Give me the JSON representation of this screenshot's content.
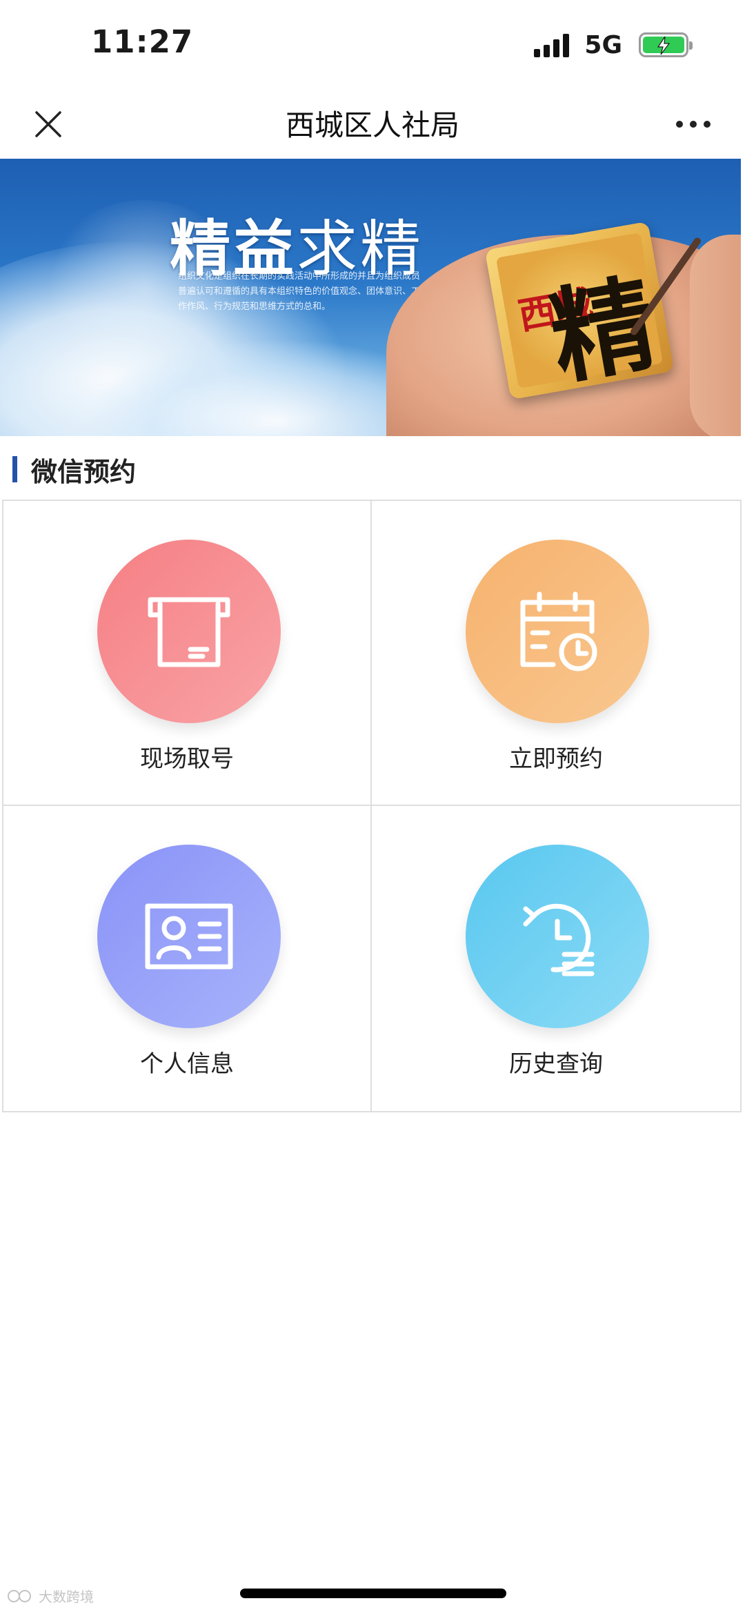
{
  "status_bar": {
    "time": "11:27",
    "network": "5G",
    "battery_level": 1.0,
    "battery_color": "#2fcb55"
  },
  "nav": {
    "title": "西城区人社局",
    "close_icon": "close-icon",
    "more_icon": "more-dots-icon"
  },
  "banner": {
    "headline_bold": "精益",
    "headline_light": "求精",
    "description": "组织文化是组织在长期的实践活动中所形成的并且为组织成员普遍认可和遵循的具有本组织特色的价值观念、团体意识、工作作风、行为规范和思维方式的总和。",
    "seal_char": "精",
    "seal_side": "西城"
  },
  "section": {
    "title": "微信预约",
    "accent": "#2452a8"
  },
  "services": [
    {
      "label": "现场取号",
      "icon": "ticket-icon",
      "color": "#f67f84"
    },
    {
      "label": "立即预约",
      "icon": "calendar-clock-icon",
      "color": "#f6b26e"
    },
    {
      "label": "个人信息",
      "icon": "id-card-icon",
      "color": "#8a93f7"
    },
    {
      "label": "历史查询",
      "icon": "history-icon",
      "color": "#58c7ef"
    }
  ],
  "watermark": {
    "text": "大数跨境"
  }
}
